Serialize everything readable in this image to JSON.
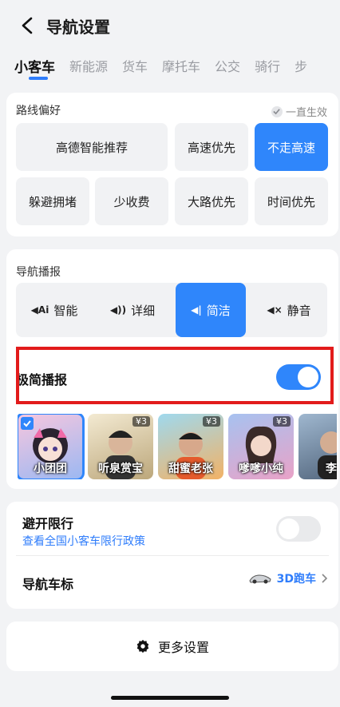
{
  "header": {
    "title": "导航设置"
  },
  "tabs": [
    "小客车",
    "新能源",
    "货车",
    "摩托车",
    "公交",
    "骑行",
    "步"
  ],
  "route": {
    "title": "路线偏好",
    "hint": "一直生效",
    "options": [
      "高德智能推荐",
      "高速优先",
      "不走高速",
      "躲避拥堵",
      "少收费",
      "大路优先",
      "时间优先"
    ],
    "selected": "不走高速"
  },
  "broadcast": {
    "title": "导航播报",
    "options": [
      {
        "icon": "◀Ai",
        "label": "智能"
      },
      {
        "icon": "◀))",
        "label": "详细"
      },
      {
        "icon": "◀|",
        "label": "简洁"
      },
      {
        "icon": "◀×",
        "label": "静音"
      }
    ],
    "selected": "简洁",
    "minimal_label": "极简播报",
    "minimal_on": true
  },
  "voices": [
    {
      "name": "小团团",
      "price": "",
      "selected": true
    },
    {
      "name": "听泉赏宝",
      "price": "¥3",
      "selected": false
    },
    {
      "name": "甜蜜老张",
      "price": "¥3",
      "selected": false
    },
    {
      "name": "嗲嗲小纯",
      "price": "¥3",
      "selected": false
    },
    {
      "name": "李",
      "price": "",
      "selected": false
    }
  ],
  "restriction": {
    "title": "避开限行",
    "link": "查看全国小客车限行政策",
    "on": false
  },
  "car_icon": {
    "title": "导航车标",
    "value": "3D跑车"
  },
  "more": {
    "label": "更多设置"
  },
  "colors": {
    "accent": "#2f86fb",
    "highlight": "#e21b1b"
  }
}
